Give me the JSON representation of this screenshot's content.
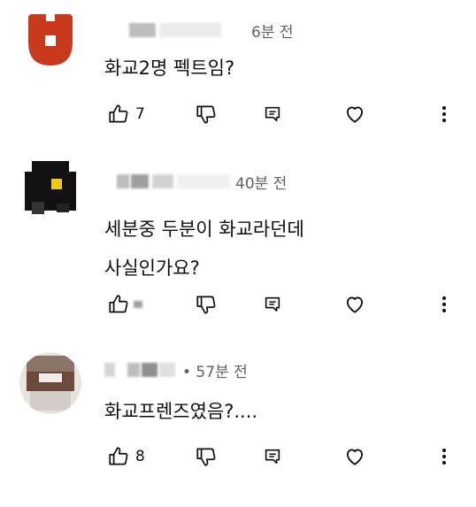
{
  "comments": [
    {
      "time": "6분 전",
      "text_lines": [
        "화교2명 펙트임?"
      ],
      "likes": "7",
      "avatar": "red-shield-avatar"
    },
    {
      "time": "40분 전",
      "text_lines": [
        "세분중 두분이 화교라던데",
        "사실인가요?"
      ],
      "likes": "",
      "avatar": "black-pixel-avatar"
    },
    {
      "time": "• 57분 전",
      "text_lines": [
        "화교프렌즈였음?...."
      ],
      "likes": "8",
      "avatar": "brown-pixel-avatar"
    }
  ],
  "icons": [
    "thumbs-up-icon",
    "thumbs-down-icon",
    "reply-icon",
    "heart-icon",
    "more-vert-icon"
  ],
  "colors": {
    "text": "#0f0f0f",
    "secondary": "#606060",
    "avatar_red": "#c83a1e"
  }
}
